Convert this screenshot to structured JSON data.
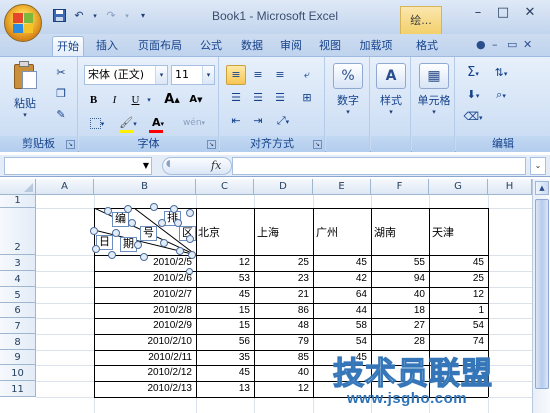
{
  "window": {
    "title": "Book1 - Microsoft Excel",
    "context_tab_label": "绘...",
    "controls": {
      "minimize": "–",
      "maximize": "□",
      "close": "✕"
    }
  },
  "quick_access": {
    "save_icon": "save-icon",
    "undo_icon": "undo-icon",
    "redo_icon": "redo-icon",
    "customize_icon": "customize-icon"
  },
  "tabs": [
    {
      "label": "开始",
      "active": true
    },
    {
      "label": "插入"
    },
    {
      "label": "页面布局"
    },
    {
      "label": "公式"
    },
    {
      "label": "数据"
    },
    {
      "label": "审阅"
    },
    {
      "label": "视图"
    },
    {
      "label": "加载项"
    },
    {
      "label": "格式"
    }
  ],
  "ribbon": {
    "clipboard": {
      "label": "剪贴板",
      "paste_label": "粘贴"
    },
    "font": {
      "label": "字体",
      "font_name": "宋体 (正文)",
      "font_size": "11",
      "bold": "B",
      "italic": "I",
      "underline": "U",
      "grow": "A",
      "shrink": "A",
      "font_color": "A",
      "phonetic": "wén"
    },
    "alignment": {
      "label": "对齐方式"
    },
    "number": {
      "label": "数字",
      "percent": "%"
    },
    "styles": {
      "label": "样式"
    },
    "cells": {
      "label": "单元格"
    },
    "editing": {
      "label": "编辑",
      "sum": "Σ"
    }
  },
  "formula_bar": {
    "name_box": "",
    "fx": "fx",
    "formula": ""
  },
  "sheet": {
    "columns": [
      "A",
      "B",
      "C",
      "D",
      "E",
      "F",
      "G",
      "H"
    ],
    "rows": [
      "1",
      "2",
      "3",
      "4",
      "5",
      "6",
      "7",
      "8",
      "9",
      "10",
      "11"
    ],
    "cities": [
      "北京",
      "上海",
      "广州",
      "湖南",
      "天津"
    ],
    "header_shapes": [
      "编",
      "排",
      "号",
      "区",
      "日",
      "期"
    ],
    "data": [
      {
        "date": "2010/2/5",
        "values": [
          "12",
          "25",
          "45",
          "55",
          "45"
        ]
      },
      {
        "date": "2010/2/6",
        "values": [
          "53",
          "23",
          "42",
          "94",
          "25"
        ]
      },
      {
        "date": "2010/2/7",
        "values": [
          "45",
          "21",
          "64",
          "40",
          "12"
        ]
      },
      {
        "date": "2010/2/8",
        "values": [
          "15",
          "86",
          "44",
          "18",
          "1"
        ]
      },
      {
        "date": "2010/2/9",
        "values": [
          "15",
          "48",
          "58",
          "27",
          "54"
        ]
      },
      {
        "date": "2010/2/10",
        "values": [
          "56",
          "79",
          "54",
          "28",
          "74"
        ]
      },
      {
        "date": "2010/2/11",
        "values": [
          "35",
          "85",
          "45",
          "",
          ""
        ]
      },
      {
        "date": "2010/2/12",
        "values": [
          "45",
          "40",
          "",
          "",
          ""
        ]
      },
      {
        "date": "2010/2/13",
        "values": [
          "13",
          "12",
          "",
          "",
          ""
        ]
      }
    ]
  },
  "watermark": {
    "title": "技术员联盟",
    "url": "www.jsgho.com"
  }
}
